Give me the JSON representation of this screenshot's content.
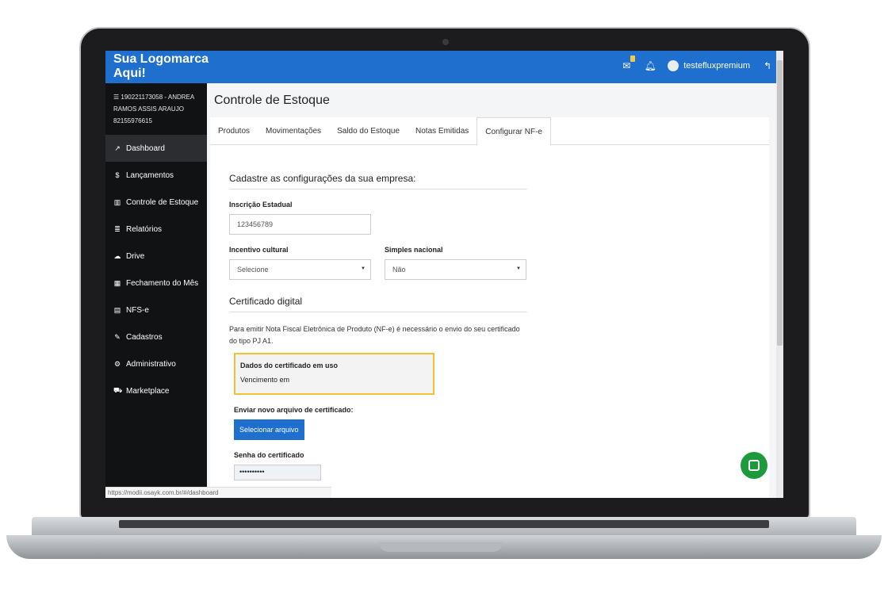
{
  "app": {
    "logo": "Sua Logomarca Aqui!"
  },
  "topbar": {
    "mail_icon": "mail-icon",
    "bell_icon": "bell-icon",
    "username": "testefluxpremium",
    "logout_icon": "reply-icon"
  },
  "sidebar": {
    "account_line1": "190221173058 - ANDREA",
    "account_line2": "RAMOS ASSIS ARAUJO",
    "account_line3": "82155976615",
    "items": [
      {
        "label": "Dashboard",
        "icon": "chart-line-icon"
      },
      {
        "label": "Lançamentos",
        "icon": "dollar-icon"
      },
      {
        "label": "Controle de Estoque",
        "icon": "bar-chart-icon"
      },
      {
        "label": "Relatórios",
        "icon": "list-icon"
      },
      {
        "label": "Drive",
        "icon": "cloud-icon"
      },
      {
        "label": "Fechamento do Mês",
        "icon": "calendar-icon"
      },
      {
        "label": "NFS-e",
        "icon": "file-icon"
      },
      {
        "label": "Cadastros",
        "icon": "edit-icon"
      },
      {
        "label": "Administrativo",
        "icon": "gear-icon"
      },
      {
        "label": "Marketplace",
        "icon": "cart-icon"
      }
    ]
  },
  "main": {
    "title": "Controle de Estoque",
    "tabs": [
      {
        "label": "Produtos"
      },
      {
        "label": "Movimentações"
      },
      {
        "label": "Saldo do Estoque"
      },
      {
        "label": "Notas Emitidas"
      },
      {
        "label": "Configurar NF-e"
      }
    ]
  },
  "form": {
    "section_title": "Cadastre as configurações da sua empresa:",
    "inscricao_label": "Inscrição Estadual",
    "inscricao_value": "123456789",
    "incentivo_label": "Incentivo cultural",
    "incentivo_value": "Selecione",
    "simples_label": "Simples nacional",
    "simples_value": "Não",
    "cert_section_title": "Certificado digital",
    "cert_paragraph": "Para emitir Nota Fiscal Eletrônica de Produto (NF-e) é necessário o envio do seu certificado do tipo PJ A1.",
    "cert_box_title": "Dados do certificado em uso",
    "cert_box_text": "Vencimento em",
    "upload_label": "Enviar novo arquivo de certificado:",
    "upload_button": "Selecionar arquivo",
    "password_label": "Senha do certificado",
    "password_value": "••••••••••"
  },
  "status_url": "https://modii.osayk.com.br/#/dashboard",
  "colors": {
    "accent": "#1f6fcf",
    "sidebar": "#111214",
    "highlight": "#f1c232",
    "chat": "#1d9a3b"
  }
}
